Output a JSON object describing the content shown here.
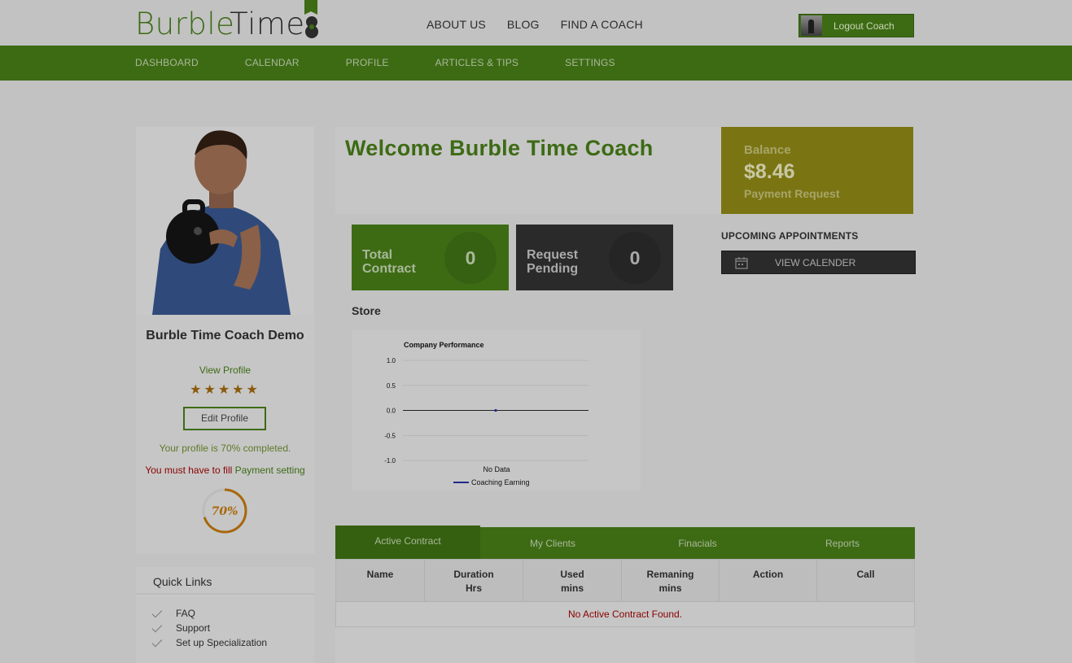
{
  "brand": {
    "name_part1": "Burble",
    "name_part2": "Time"
  },
  "top_nav": [
    "ABOUT US",
    "BLOG",
    "FIND A COACH"
  ],
  "logout_label": "Logout Coach",
  "main_nav": [
    "DASHBOARD",
    "CALENDAR",
    "PROFILE",
    "ARTICLES & TIPS",
    "SETTINGS"
  ],
  "profile": {
    "name": "Burble Time Coach Demo",
    "view_profile": "View Profile",
    "stars": "★★★★★",
    "rating": 5,
    "edit_profile": "Edit Profile",
    "completion_text": "Your profile is 70% completed.",
    "must_fill_text": "You must have to fill",
    "payment_setting_link": "Payment setting",
    "completion_ring_label": "70%",
    "completion_fraction": 0.7
  },
  "quick_links": {
    "title": "Quick Links",
    "items": [
      "FAQ",
      "Support",
      "Set up Specialization"
    ]
  },
  "welcome": "Welcome Burble Time Coach",
  "balance": {
    "label": "Balance",
    "amount": "$8.46",
    "link": "Payment Request"
  },
  "stats": [
    {
      "label_line1": "Total",
      "label_line2": "Contract",
      "value": "0"
    },
    {
      "label_line1": "Request",
      "label_line2": "Pending",
      "value": "0"
    }
  ],
  "upcoming": {
    "title": "UPCOMING APPOINTMENTS",
    "button": "VIEW CALENDER"
  },
  "store_title": "Store",
  "chart_data": {
    "type": "line",
    "title": "Company Performance",
    "xlabel": "No Data",
    "ylabel": "",
    "ylim": [
      -1.0,
      1.0
    ],
    "yticks": [
      "1.0",
      "0.5",
      "0.0",
      "-0.5",
      "-1.0"
    ],
    "grid": true,
    "legend": "bottom",
    "series": [
      {
        "name": "Coaching Earning",
        "color": "#1e2a8c",
        "x": [
          0
        ],
        "y": [
          0
        ]
      }
    ]
  },
  "tabs": [
    "Active Contract",
    "My Clients",
    "Finacials",
    "Reports"
  ],
  "active_tab": 0,
  "table": {
    "headers": [
      {
        "l1": "Name",
        "l2": ""
      },
      {
        "l1": "Duration",
        "l2": "Hrs"
      },
      {
        "l1": "Used",
        "l2": "mins"
      },
      {
        "l1": "Remaning",
        "l2": "mins"
      },
      {
        "l1": "Action",
        "l2": ""
      },
      {
        "l1": "Call",
        "l2": ""
      }
    ],
    "empty_message": "No Active Contract Found."
  },
  "colors": {
    "brand_green": "#3d6b14",
    "balance_olive": "#7a7512",
    "dark": "#2a2a2a",
    "overlay_gray": "#c2c2c2"
  }
}
